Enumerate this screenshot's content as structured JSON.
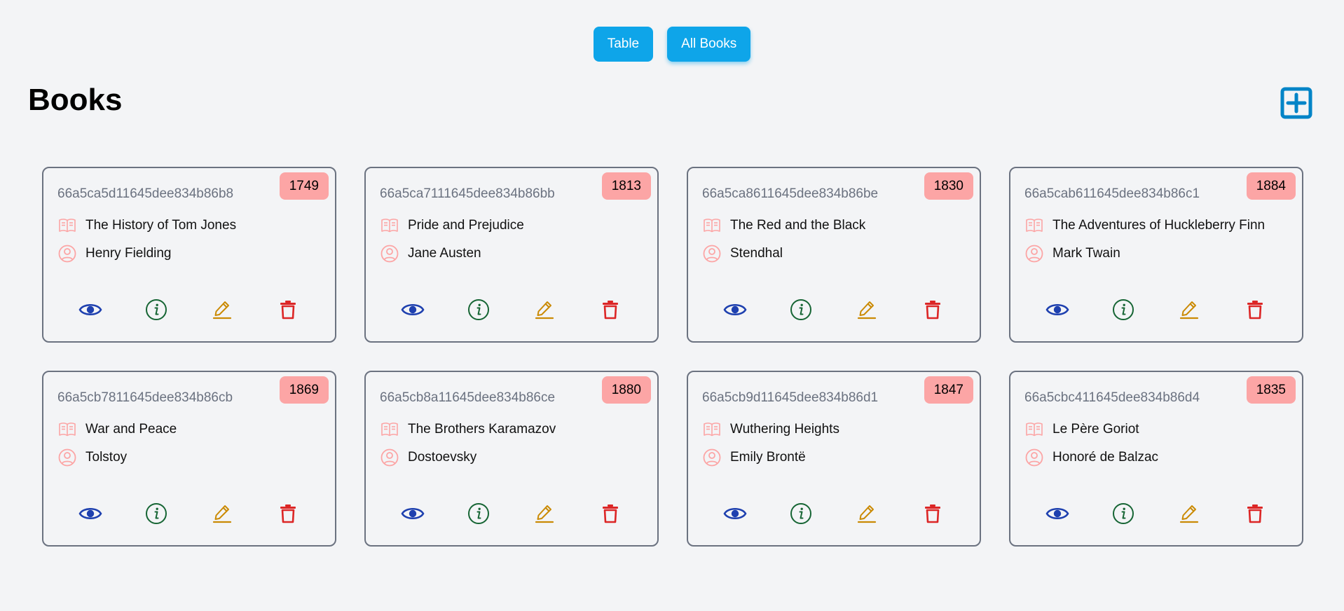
{
  "nav": {
    "table_label": "Table",
    "all_books_label": "All Books"
  },
  "page": {
    "title": "Books"
  },
  "colors": {
    "accent": "#0ea5e9",
    "badge": "#fca5a5",
    "view": "#1e40af",
    "info": "#166534",
    "edit": "#ca8a04",
    "delete": "#dc2626",
    "meta_icon": "#f87171",
    "add": "#0284c7"
  },
  "icons": {
    "add": "plus-square-icon",
    "title": "book-open-icon",
    "author": "user-circle-icon",
    "view": "eye-icon",
    "info": "info-circle-icon",
    "edit": "pencil-icon",
    "delete": "trash-icon"
  },
  "books": [
    {
      "id": "66a5ca5d11645dee834b86b8",
      "year": "1749",
      "title": "The History of Tom Jones",
      "author": "Henry Fielding"
    },
    {
      "id": "66a5ca7111645dee834b86bb",
      "year": "1813",
      "title": "Pride and Prejudice",
      "author": "Jane Austen"
    },
    {
      "id": "66a5ca8611645dee834b86be",
      "year": "1830",
      "title": "The Red and the Black",
      "author": "Stendhal"
    },
    {
      "id": "66a5cab611645dee834b86c1",
      "year": "1884",
      "title": "The Adventures of Huckleberry Finn",
      "author": "Mark Twain"
    },
    {
      "id": "66a5cb7811645dee834b86cb",
      "year": "1869",
      "title": "War and Peace",
      "author": "Tolstoy"
    },
    {
      "id": "66a5cb8a11645dee834b86ce",
      "year": "1880",
      "title": "The Brothers Karamazov",
      "author": "Dostoevsky"
    },
    {
      "id": "66a5cb9d11645dee834b86d1",
      "year": "1847",
      "title": "Wuthering Heights",
      "author": "Emily Brontë"
    },
    {
      "id": "66a5cbc411645dee834b86d4",
      "year": "1835",
      "title": "Le Père Goriot",
      "author": "Honoré de Balzac"
    }
  ]
}
